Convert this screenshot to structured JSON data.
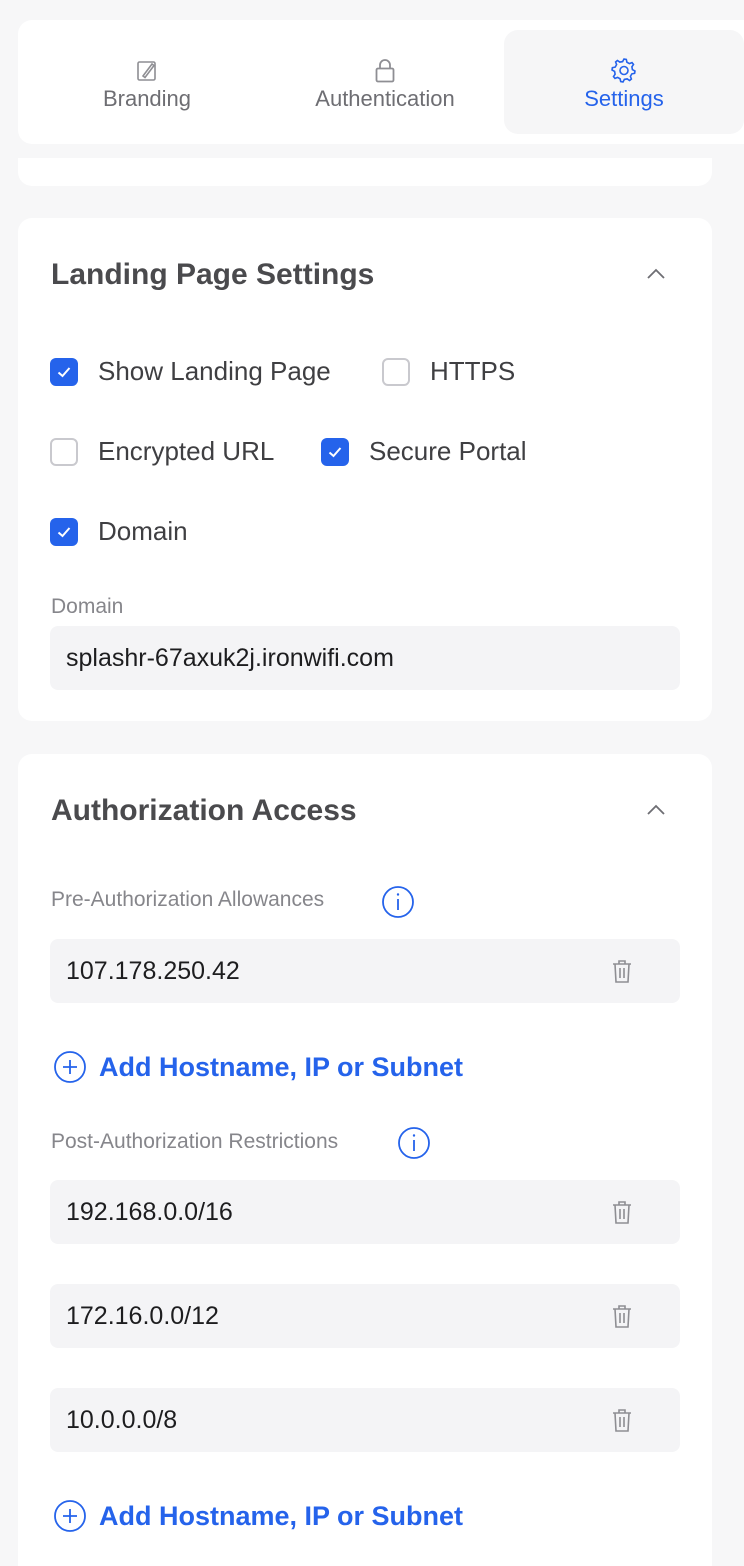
{
  "tabs": [
    {
      "label": "Branding",
      "icon": "edit-note-icon",
      "active": false
    },
    {
      "label": "Authentication",
      "icon": "lock-icon",
      "active": false
    },
    {
      "label": "Settings",
      "icon": "gear-icon",
      "active": true
    }
  ],
  "landing": {
    "title": "Landing Page Settings",
    "options": {
      "show_landing_page": {
        "label": "Show Landing Page",
        "checked": true
      },
      "https": {
        "label": "HTTPS",
        "checked": false
      },
      "encrypted_url": {
        "label": "Encrypted URL",
        "checked": false
      },
      "secure_portal": {
        "label": "Secure Portal",
        "checked": true
      },
      "domain": {
        "label": "Domain",
        "checked": true
      }
    },
    "domain_label": "Domain",
    "domain_value": "splashr-67axuk2j.ironwifi.com"
  },
  "auth": {
    "title": "Authorization Access",
    "pre_label": "Pre-Authorization Allowances",
    "pre_entries": [
      "107.178.250.42"
    ],
    "post_label": "Post-Authorization Restrictions",
    "post_entries": [
      "192.168.0.0/16",
      "172.16.0.0/12",
      "10.0.0.0/8"
    ],
    "add_label": "Add Hostname, IP or Subnet"
  },
  "colors": {
    "accent": "#2563eb",
    "background": "#f7f7f8",
    "input_bg": "#f4f4f6"
  }
}
